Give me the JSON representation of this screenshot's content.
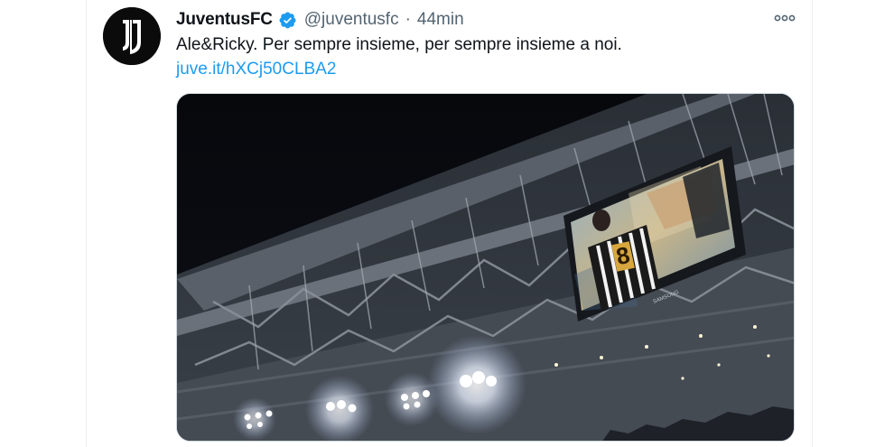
{
  "tweet": {
    "author_name": "JuventusFC",
    "handle": "@juventusfc",
    "separator": "·",
    "time": "44min",
    "text": "Ale&Ricky. Per sempre insieme, per sempre insieme a noi.",
    "link": "juve.it/hXCj50CLBA2",
    "icons": {
      "avatar": "juventus-logo",
      "verified": "verified-badge-icon",
      "more": "more-options-icon"
    },
    "colors": {
      "link": "#1d9bf0",
      "verified": "#1d9bf0",
      "secondary_text": "#536471",
      "primary_text": "#0f1419"
    }
  },
  "media": {
    "jersey_number": "8",
    "screen_brand": "SAMSUNG"
  }
}
